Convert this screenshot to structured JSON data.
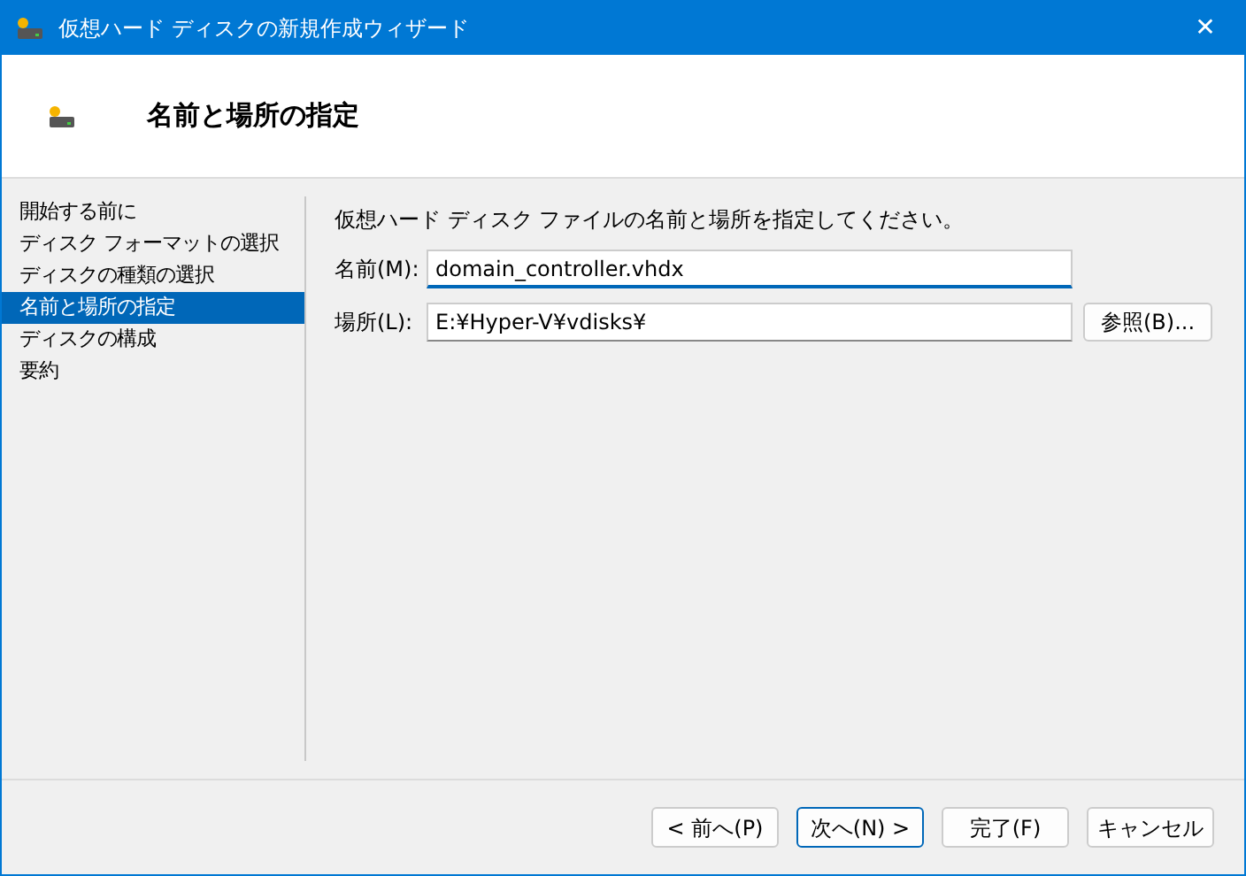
{
  "window": {
    "title": "仮想ハード ディスクの新規作成ウィザード",
    "close": "✕"
  },
  "header": {
    "title": "名前と場所の指定"
  },
  "steps": [
    {
      "label": "開始する前に",
      "selected": false
    },
    {
      "label": "ディスク フォーマットの選択",
      "selected": false
    },
    {
      "label": "ディスクの種類の選択",
      "selected": false
    },
    {
      "label": "名前と場所の指定",
      "selected": true
    },
    {
      "label": "ディスクの構成",
      "selected": false
    },
    {
      "label": "要約",
      "selected": false
    }
  ],
  "instruction": "仮想ハード ディスク ファイルの名前と場所を指定してください。",
  "fields": [
    {
      "label": "名前(M):",
      "value": "domain_controller.vhdx",
      "focused": true
    },
    {
      "label": "場所(L):",
      "value": "E:¥Hyper-V¥vdisks¥",
      "focused": false,
      "button": "参照(B)..."
    }
  ],
  "buttons": [
    {
      "label": "< 前へ(P)",
      "default": false
    },
    {
      "label": "次へ(N) >",
      "default": true
    },
    {
      "label": "完了(F)",
      "default": false
    },
    {
      "label": "キャンセル",
      "default": false
    }
  ]
}
